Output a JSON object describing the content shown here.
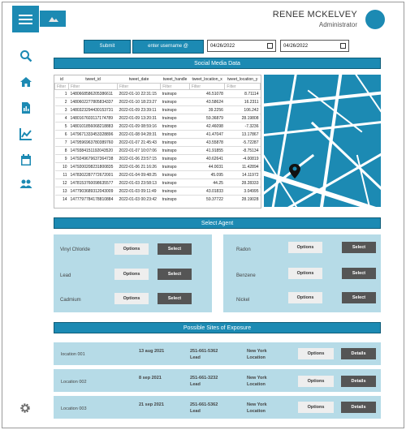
{
  "header": {
    "user_name": "RENEE MCKELVEY",
    "user_role": "Administrator"
  },
  "toolbar": {
    "submit_label": "Submit",
    "username_label": "enter username @",
    "date_from": "04/26/2022",
    "date_to": "04/26/2022"
  },
  "sidebar": {
    "icons": [
      "search-icon",
      "home-icon",
      "document-icon",
      "chart-icon",
      "calendar-icon",
      "people-icon"
    ],
    "settings_icon": "gear-icon"
  },
  "social": {
    "title": "Social Media Data",
    "columns": [
      "id",
      "tweet_id",
      "tweet_date",
      "tweet_handle",
      "tweet_location_x",
      "tweet_location_y"
    ],
    "filter_placeholder": "Filter",
    "rows": [
      [
        "1",
        "1480668586205386611",
        "2022-01-10 22:31:15",
        "trainspo",
        "46.51078",
        "8.71114"
      ],
      [
        "2",
        "1480602277805834337",
        "2022-01-10 18:23:27",
        "trainspo",
        "43.58624",
        "16.2311"
      ],
      [
        "3",
        "1480323294430153731",
        "2022-01-09 23:39:11",
        "trainspo",
        "39.2256",
        "106.242"
      ],
      [
        "4",
        "1480167603117174789",
        "2022-01-09 13:20:31",
        "trainspo",
        "59.36879",
        "28.19808"
      ],
      [
        "5",
        "1480101856068218883",
        "2022-01-09 08:59:16",
        "trainspo",
        "42.46098",
        "-7.3236"
      ],
      [
        "6",
        "1479671333453328896",
        "2022-01-08 04:28:31",
        "trainspo",
        "41.47047",
        "13.17867"
      ],
      [
        "7",
        "1479596963780389760",
        "2022-01-07 21:45:43",
        "trainspo",
        "43.55878",
        "-5.72287"
      ],
      [
        "8",
        "1479384151192043520",
        "2022-01-07 10:07:06",
        "trainspo",
        "41.91855",
        "-8.75134"
      ],
      [
        "9",
        "1479249679637364738",
        "2022-01-06 23:57:15",
        "trainspo",
        "40.62641",
        "-4.00819"
      ],
      [
        "10",
        "1479200208231800835",
        "2022-01-06 21:16:26",
        "trainspo",
        "44.0031",
        "11.42894"
      ],
      [
        "11",
        "1478302287772672001",
        "2022-01-04 09:48:25",
        "trainspo",
        "45.095",
        "14.11972"
      ],
      [
        "12",
        "1478153760098635577",
        "2022-01-03 23:58:13",
        "trainspo",
        "44.25",
        "28.28333"
      ],
      [
        "13",
        "1477903689312043009",
        "2022-01-03 09:11:49",
        "trainspo",
        "43.01833",
        "3.04995"
      ],
      [
        "14",
        "1477797784178810884",
        "2022-01-03 00:23:42",
        "trainspo",
        "59.37722",
        "28.19028"
      ]
    ]
  },
  "agents": {
    "title": "Select Agent",
    "options_label": "Options",
    "select_label": "Select",
    "left": [
      "Vinyl Chloride",
      "Lead",
      "Cadmium"
    ],
    "right": [
      "Radon",
      "Benzene",
      "Nickel"
    ]
  },
  "sites": {
    "title": "Possible Sites of Exposure",
    "options_label": "Options",
    "details_label": "Details",
    "rows": [
      {
        "name": "location 001",
        "date": "13 aug 2021",
        "phone": "251-661-5362",
        "agent": "Lead",
        "city": "New York",
        "type": "Location"
      },
      {
        "name": "Location 002",
        "date": "8 sep 2021",
        "phone": "251-661-3232",
        "agent": "Lead",
        "city": "New York",
        "type": "Location"
      },
      {
        "name": "Location 003",
        "date": "21 sep 2021",
        "phone": "251-661-5362",
        "agent": "Lead",
        "city": "New York",
        "type": "Location"
      }
    ]
  },
  "colors": {
    "accent": "#1c8ab3",
    "panel": "#b6dbe7",
    "dark_button": "#555555"
  }
}
